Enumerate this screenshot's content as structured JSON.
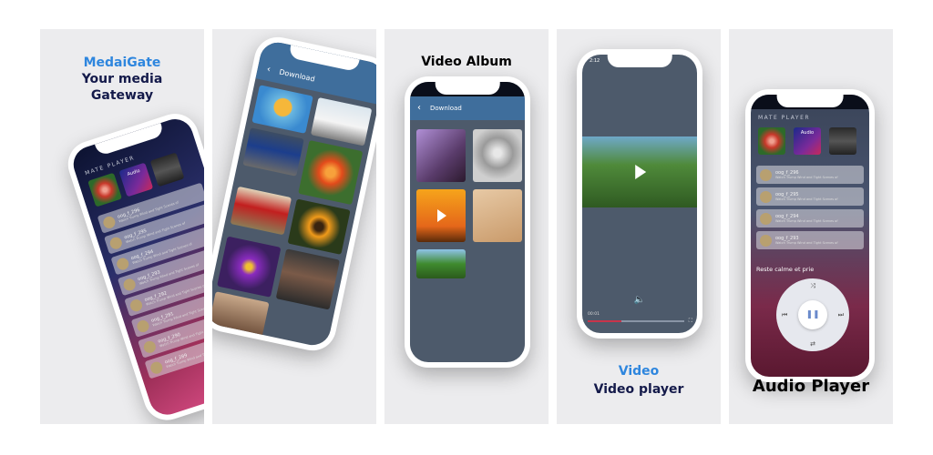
{
  "panel1": {
    "title_line1": "MedaiGate",
    "title_line2": "Your media",
    "title_line3": "Gateway",
    "section_label": "MATE PLAYER",
    "audio_tile_label": "Audio",
    "songs": [
      {
        "title": "oog_f_296",
        "subtitle": "Watch Trump Wind and Tight Scenes of"
      },
      {
        "title": "oog_f_295",
        "subtitle": "Watch Trump Wind and Tight Scenes of"
      },
      {
        "title": "oog_f_294",
        "subtitle": "Watch Trump Wind and Tight Scenes of"
      },
      {
        "title": "oog_f_293",
        "subtitle": "Watch Trump Wind and Tight Scenes of"
      },
      {
        "title": "oog_f_292",
        "subtitle": "Watch Trump Wind and Tight Scenes of"
      },
      {
        "title": "oog_f_291",
        "subtitle": "Watch Trump Wind and Tight Scenes of"
      },
      {
        "title": "oog_f_290",
        "subtitle": "Watch Trump Wind and Tight Scenes of"
      },
      {
        "title": "oog_f_289",
        "subtitle": "Watch Trump Wind and Tight Scenes of"
      }
    ]
  },
  "panel2": {
    "appbar_title": "Download"
  },
  "panel3": {
    "caption": "Video Album",
    "appbar_title": "Download"
  },
  "panel4": {
    "status_time": "2:12",
    "time_elapsed": "00:01",
    "caption_line1": "Video",
    "caption_line2": "Video player",
    "progress_fraction": 0.35
  },
  "panel5": {
    "section_label": "MATE PLAYER",
    "audio_tile_label": "Audio",
    "songs": [
      {
        "title": "oog_f_296",
        "subtitle": "Watch Trump Wind and Tight Scenes of"
      },
      {
        "title": "oog_f_295",
        "subtitle": "Watch Trump Wind and Tight Scenes of"
      },
      {
        "title": "oog_f_294",
        "subtitle": "Watch Trump Wind and Tight Scenes of"
      },
      {
        "title": "oog_f_293",
        "subtitle": "Watch Trump Wind and Tight Scenes of"
      }
    ],
    "now_playing": "Reste calme et prie",
    "caption": "Audio Player"
  }
}
